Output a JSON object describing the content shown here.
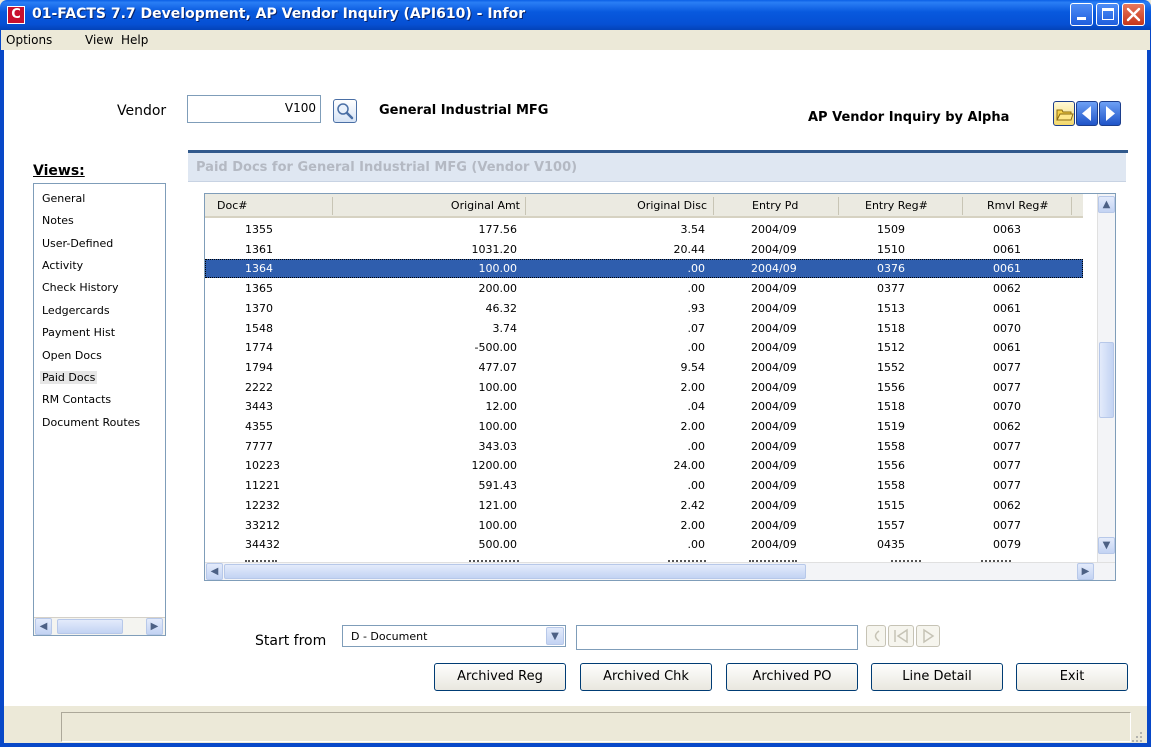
{
  "window": {
    "app_icon_letter": "C",
    "title": "01-FACTS 7.7 Development, AP Vendor Inquiry (API610) - Infor"
  },
  "menu": [
    "Options",
    "View",
    "Help"
  ],
  "vendor": {
    "label": "Vendor",
    "value": "V100",
    "name": "General Industrial MFG"
  },
  "inquiry_mode": "AP Vendor Inquiry by Alpha",
  "views": {
    "title": "Views:",
    "items": [
      "General",
      "Notes",
      "User-Defined",
      "Activity",
      "Check History",
      "Ledgercards",
      "Payment Hist",
      "Open Docs",
      "Paid Docs",
      "RM Contacts",
      "Document Routes"
    ],
    "selected": "Paid Docs"
  },
  "panel": {
    "title": "Paid Docs for General Industrial MFG (Vendor V100)"
  },
  "grid": {
    "columns": [
      "Doc#",
      "Original Amt",
      "Original Disc",
      "Entry Pd",
      "Entry Reg#",
      "Rmvl Reg#"
    ],
    "selected_index": 2,
    "rows": [
      [
        "1355",
        "177.56",
        "3.54",
        "2004/09",
        "1509",
        "0063"
      ],
      [
        "1361",
        "1031.20",
        "20.44",
        "2004/09",
        "1510",
        "0061"
      ],
      [
        "1364",
        "100.00",
        ".00",
        "2004/09",
        "0376",
        "0061"
      ],
      [
        "1365",
        "200.00",
        ".00",
        "2004/09",
        "0377",
        "0062"
      ],
      [
        "1370",
        "46.32",
        ".93",
        "2004/09",
        "1513",
        "0061"
      ],
      [
        "1548",
        "3.74",
        ".07",
        "2004/09",
        "1518",
        "0070"
      ],
      [
        "1774",
        "-500.00",
        ".00",
        "2004/09",
        "1512",
        "0061"
      ],
      [
        "1794",
        "477.07",
        "9.54",
        "2004/09",
        "1552",
        "0077"
      ],
      [
        "2222",
        "100.00",
        "2.00",
        "2004/09",
        "1556",
        "0077"
      ],
      [
        "3443",
        "12.00",
        ".04",
        "2004/09",
        "1518",
        "0070"
      ],
      [
        "4355",
        "100.00",
        "2.00",
        "2004/09",
        "1519",
        "0062"
      ],
      [
        "7777",
        "343.03",
        ".00",
        "2004/09",
        "1558",
        "0077"
      ],
      [
        "10223",
        "1200.00",
        "24.00",
        "2004/09",
        "1556",
        "0077"
      ],
      [
        "11221",
        "591.43",
        ".00",
        "2004/09",
        "1558",
        "0077"
      ],
      [
        "12232",
        "121.00",
        "2.42",
        "2004/09",
        "1515",
        "0062"
      ],
      [
        "33212",
        "100.00",
        "2.00",
        "2004/09",
        "1557",
        "0077"
      ],
      [
        "34432",
        "500.00",
        ".00",
        "2004/09",
        "0435",
        "0079"
      ]
    ]
  },
  "start_from": {
    "label": "Start from",
    "selected": "D - Document",
    "value": ""
  },
  "buttons": {
    "archived_reg": "Archived Reg",
    "archived_chk": "Archived Chk",
    "archived_po": "Archived PO",
    "line_detail": "Line Detail",
    "exit": "Exit"
  },
  "colors": {
    "titlebar": "#0859de",
    "selection": "#2f5eae",
    "panel_accent": "#31598c"
  },
  "icons": [
    "app-icon",
    "minimize-icon",
    "maximize-icon",
    "close-icon",
    "search-icon",
    "folder-icon",
    "previous-icon",
    "next-icon"
  ]
}
